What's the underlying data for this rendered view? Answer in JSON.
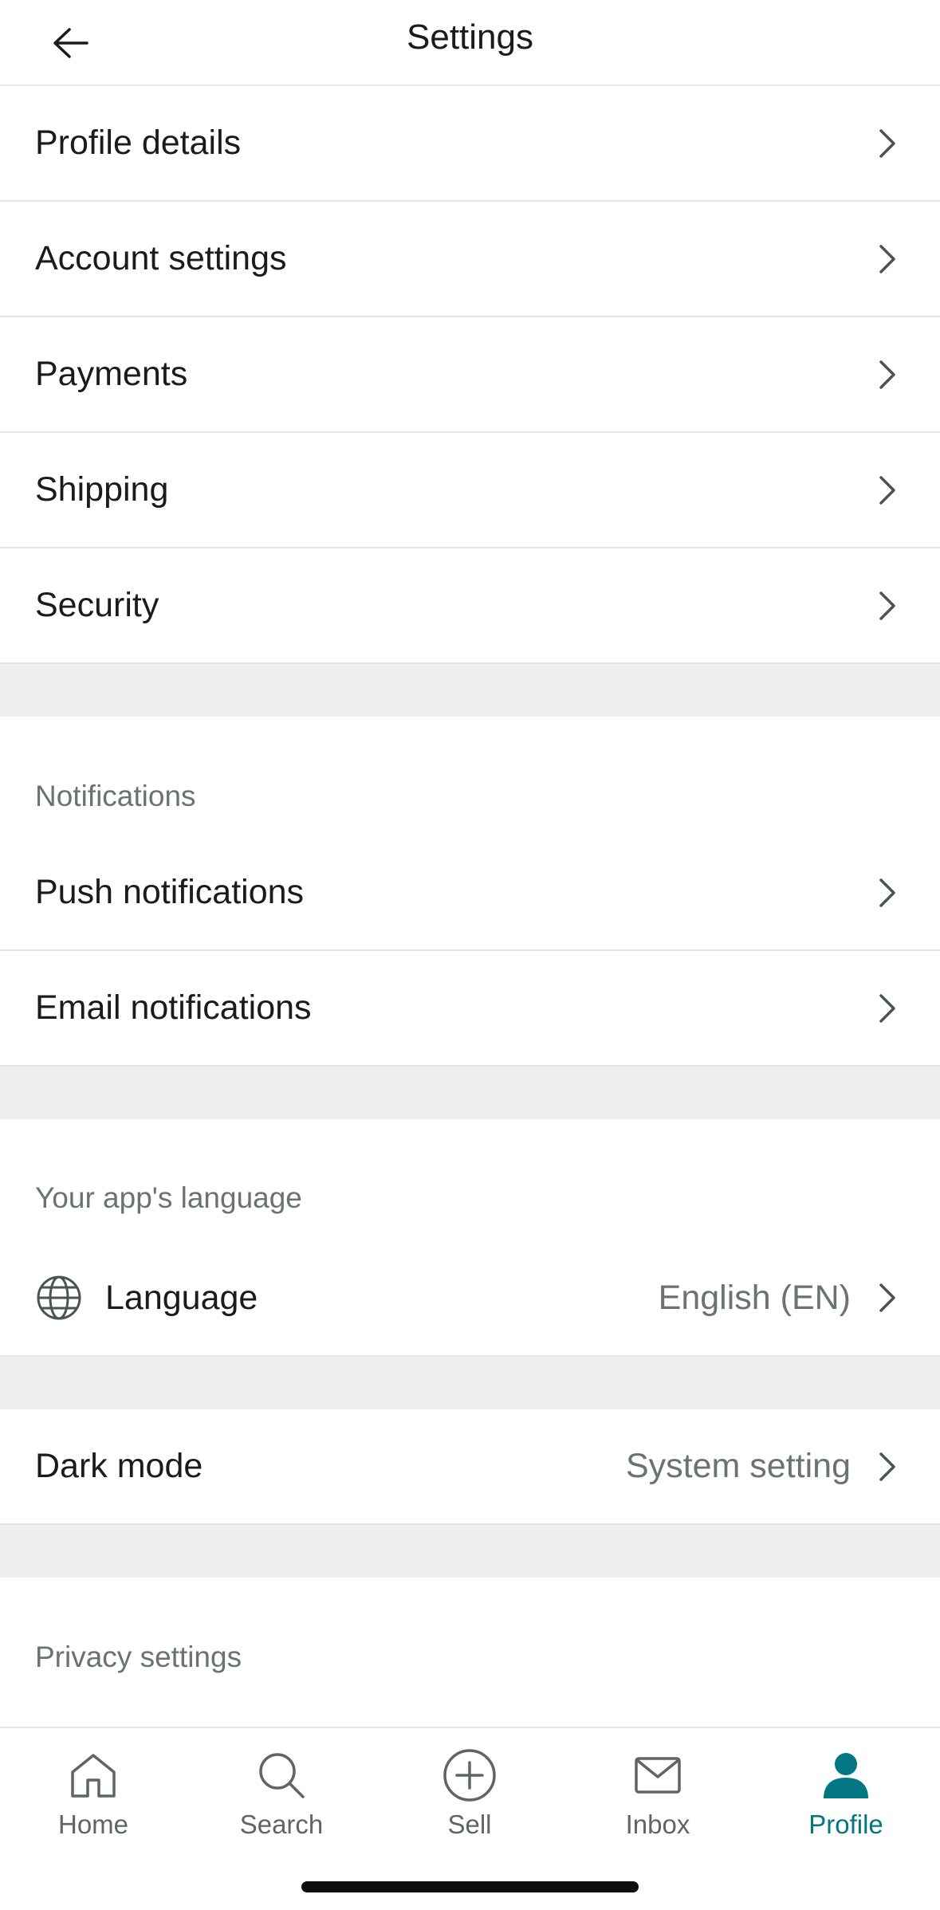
{
  "header": {
    "title": "Settings",
    "back_icon": "arrow-left-icon"
  },
  "account_rows": [
    {
      "label": "Profile details"
    },
    {
      "label": "Account settings"
    },
    {
      "label": "Payments"
    },
    {
      "label": "Shipping"
    },
    {
      "label": "Security"
    }
  ],
  "notifications": {
    "section_title": "Notifications",
    "rows": [
      {
        "label": "Push notifications"
      },
      {
        "label": "Email notifications"
      }
    ]
  },
  "language": {
    "section_title": "Your app's language",
    "label": "Language",
    "value": "English (EN)",
    "icon": "globe-icon"
  },
  "dark_mode": {
    "label": "Dark mode",
    "value": "System setting"
  },
  "privacy": {
    "section_title": "Privacy settings"
  },
  "bottom_nav": {
    "items": [
      {
        "label": "Home",
        "icon": "home-icon"
      },
      {
        "label": "Search",
        "icon": "search-icon"
      },
      {
        "label": "Sell",
        "icon": "plus-circle-icon"
      },
      {
        "label": "Inbox",
        "icon": "mail-icon"
      },
      {
        "label": "Profile",
        "icon": "person-icon",
        "active": true
      }
    ],
    "active_color": "#007782"
  }
}
